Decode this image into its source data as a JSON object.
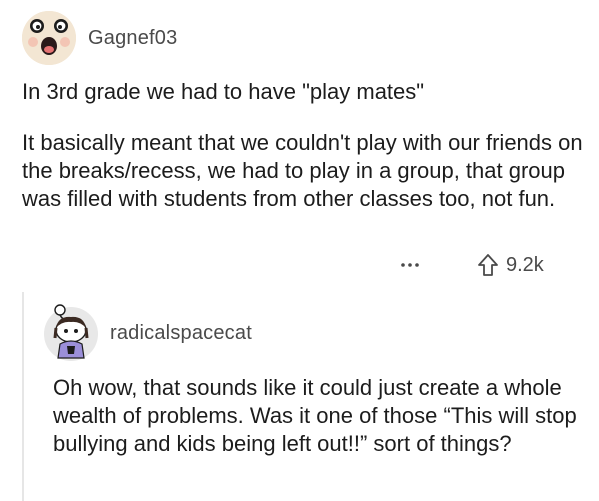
{
  "comment": {
    "username": "Gagnef03",
    "avatar_icon": "surprised-face-avatar",
    "title": "In 3rd grade we had to have \"play mates\"",
    "body": "It basically meant that we couldn't play with our friends on the breaks/recess, we had to play in a group, that group was filled with students from other classes too, not fun.",
    "more_label": "...",
    "upvote_icon": "upvote-arrow-icon",
    "score": "9.2k"
  },
  "reply": {
    "username": "radicalspacecat",
    "avatar_icon": "snoo-character-avatar",
    "body": "Oh wow, that sounds like it could just create a whole wealth of problems. Was it one of those “This will stop bullying and kids being left out!!” sort of things?"
  },
  "colors": {
    "text": "#1c1c1c",
    "meta": "#4a4a4a",
    "thread_line": "#e6e6e6",
    "avatar1_bg": "#f3e6d3",
    "avatar2_bg": "#e8e8e8"
  }
}
